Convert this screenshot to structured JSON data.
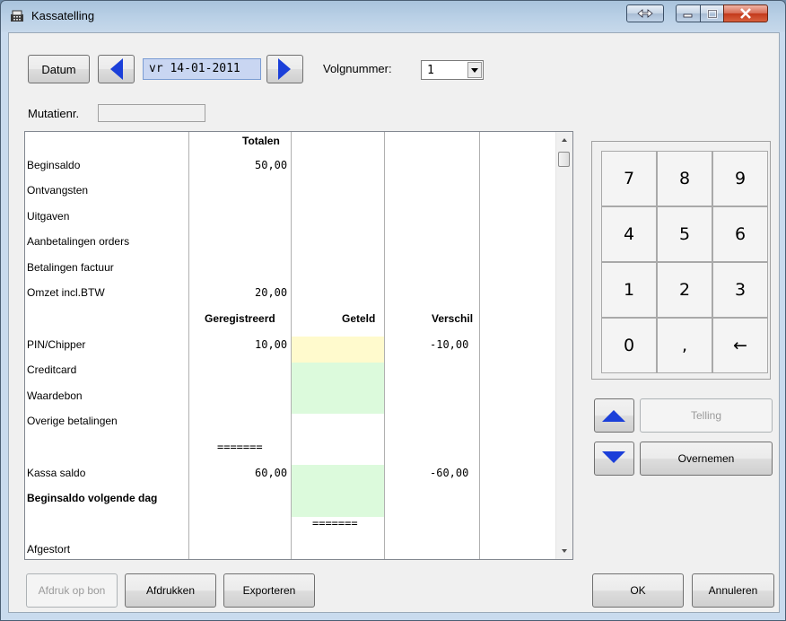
{
  "window": {
    "title": "Kassatelling"
  },
  "toolbar": {
    "datum_label": "Datum",
    "date_value": "vr 14-01-2011",
    "volgnummer_label": "Volgnummer:",
    "volgnummer_value": "1",
    "mutatienr_label": "Mutatienr.",
    "mutatienr_value": ""
  },
  "grid": {
    "header_totalen": "Totalen",
    "rows_top": [
      {
        "label": "Beginsaldo",
        "value": "50,00"
      },
      {
        "label": "Ontvangsten",
        "value": ""
      },
      {
        "label": "Uitgaven",
        "value": ""
      },
      {
        "label": "Aanbetalingen orders",
        "value": ""
      },
      {
        "label": "Betalingen factuur",
        "value": ""
      },
      {
        "label": "Omzet incl.BTW",
        "value": "20,00"
      }
    ],
    "header_geregistreerd": "Geregistreerd",
    "header_geteld": "Geteld",
    "header_verschil": "Verschil",
    "rows_payment": [
      {
        "label": "PIN/Chipper",
        "registered": "10,00",
        "counted": "",
        "difference": "-10,00"
      },
      {
        "label": "Creditcard",
        "registered": "",
        "counted": "",
        "difference": ""
      },
      {
        "label": "Waardebon",
        "registered": "",
        "counted": "",
        "difference": ""
      },
      {
        "label": "Overige betalingen",
        "registered": "",
        "counted": "",
        "difference": ""
      }
    ],
    "separator": "=======",
    "kassa_saldo": {
      "label": "Kassa saldo",
      "registered": "60,00",
      "difference": "-60,00"
    },
    "beginsaldo_volgende": {
      "label": "Beginsaldo volgende dag"
    },
    "separator2": "=======",
    "afgestort": {
      "label": "Afgestort"
    }
  },
  "keypad": {
    "keys": [
      "7",
      "8",
      "9",
      "4",
      "5",
      "6",
      "1",
      "2",
      "3",
      "0",
      ",",
      "←"
    ]
  },
  "side": {
    "telling_label": "Telling",
    "overnemen_label": "Overnemen"
  },
  "footer": {
    "afdruk_op_bon": "Afdruk op bon",
    "afdrukken": "Afdrukken",
    "exporteren": "Exporteren",
    "ok": "OK",
    "annuleren": "Annuleren"
  },
  "colors": {
    "selected_yellow": "#fffacd",
    "editable_green": "#dcfadc",
    "arrow_blue": "#1b3fd9"
  }
}
